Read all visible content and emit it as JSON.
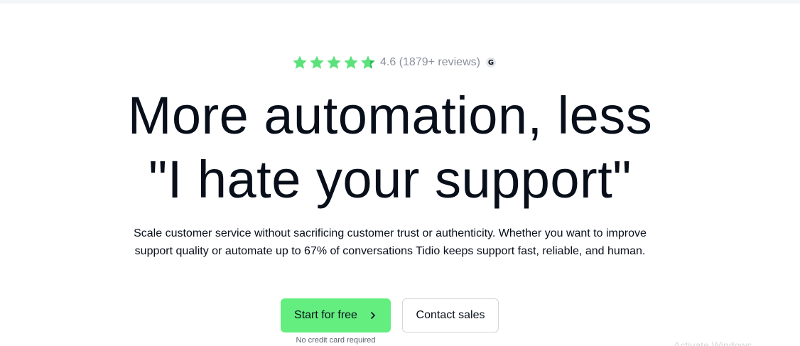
{
  "hero": {
    "rating": {
      "value_text": "4.6 (1879+ reviews)",
      "stars_value": 4.6,
      "stars_max": 5,
      "star_color": "#5ce27a",
      "source_icon": "g2-logo-icon"
    },
    "headline_line1": "More automation, less",
    "headline_line2": "\"I hate your support\"",
    "subtext_line1": "Scale customer service without sacrificing customer trust or authenticity. Whether you want to improve",
    "subtext_line2": "support quality or automate up to 67% of conversations Tidio keeps support fast, reliable, and human.",
    "primary_button_label": "Start for free",
    "primary_button_color": "#63ee7f",
    "secondary_button_label": "Contact sales",
    "note": "No credit card required"
  },
  "overlay": {
    "watermark_text": "Activate Windows"
  }
}
